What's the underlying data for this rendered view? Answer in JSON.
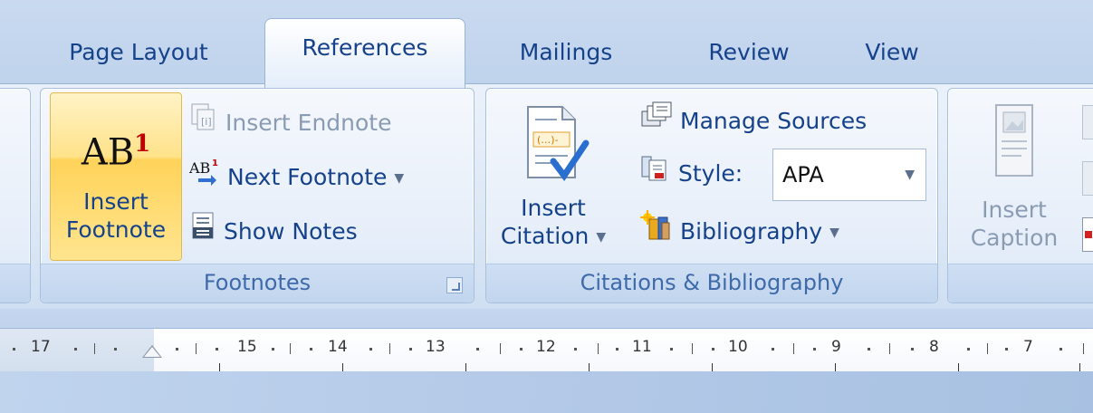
{
  "tabs": [
    "Page Layout",
    "References",
    "Mailings",
    "Review",
    "View"
  ],
  "footnotes_group": {
    "label": "Footnotes",
    "insert_footnote_line1": "Insert",
    "insert_footnote_line2": "Footnote",
    "icon_text": "AB",
    "icon_sup": "1",
    "insert_endnote": "Insert Endnote",
    "next_footnote": "Next Footnote",
    "show_notes": "Show Notes"
  },
  "citations_group": {
    "label": "Citations & Bibliography",
    "insert_citation_line1": "Insert",
    "insert_citation_line2": "Citation",
    "manage_sources": "Manage Sources",
    "style_label": "Style:",
    "style_value": "APA",
    "bibliography": "Bibliography"
  },
  "captions_group": {
    "insert_caption_line1": "Insert",
    "insert_caption_line2": "Caption"
  },
  "ruler": {
    "numbers": [
      "17",
      "15",
      "14",
      "13",
      "12",
      "11",
      "10",
      "9",
      "8",
      "7"
    ]
  }
}
